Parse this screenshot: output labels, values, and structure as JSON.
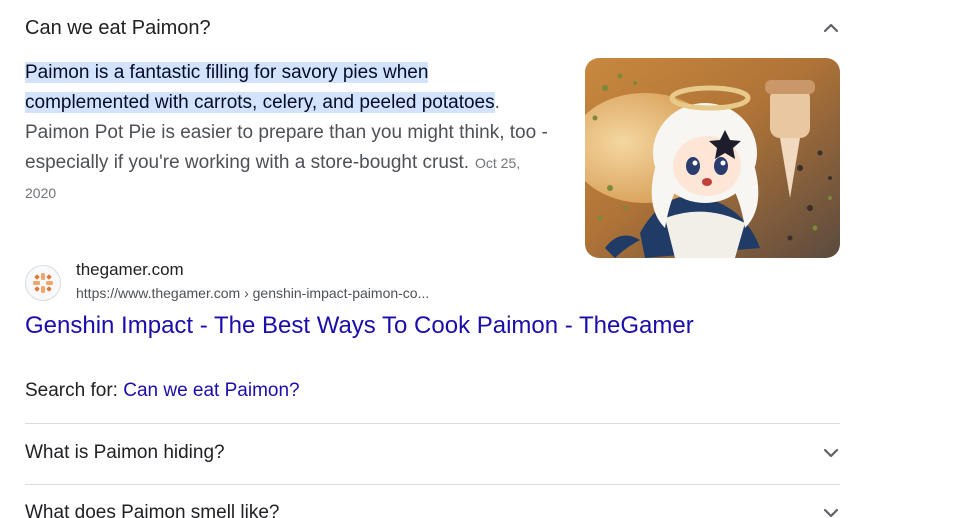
{
  "expanded_question": {
    "question": "Can we eat Paimon?",
    "toggle_icon": "chevron-up-icon",
    "answer_highlight_1": "Paimon is a fantastic filling for savory pies when",
    "answer_highlight_2": "complemented with carrots, celery, and peeled potatoes",
    "answer_period": ".",
    "answer_rest": "Paimon Pot Pie is easier to prepare than you might think, too - especially if you're working with a store-bought crust.",
    "date": "Oct 25, 2020",
    "thumbnail_icon": "paimon-thumbnail-image"
  },
  "source": {
    "favicon_icon": "thegamer-favicon-icon",
    "site_name": "thegamer.com",
    "url": "https://www.thegamer.com › genshin-impact-paimon-co...",
    "title": "Genshin Impact - The Best Ways To Cook Paimon - TheGamer"
  },
  "search_for": {
    "label": "Search for: ",
    "query": "Can we eat Paimon?"
  },
  "related_questions": [
    {
      "question": "What is Paimon hiding?",
      "toggle_icon": "chevron-down-icon"
    },
    {
      "question": "What does Paimon smell like?",
      "toggle_icon": "chevron-down-icon"
    }
  ],
  "colors": {
    "link": "#1a0dab",
    "highlight": "#d3e3fd",
    "divider": "#dadce0"
  }
}
